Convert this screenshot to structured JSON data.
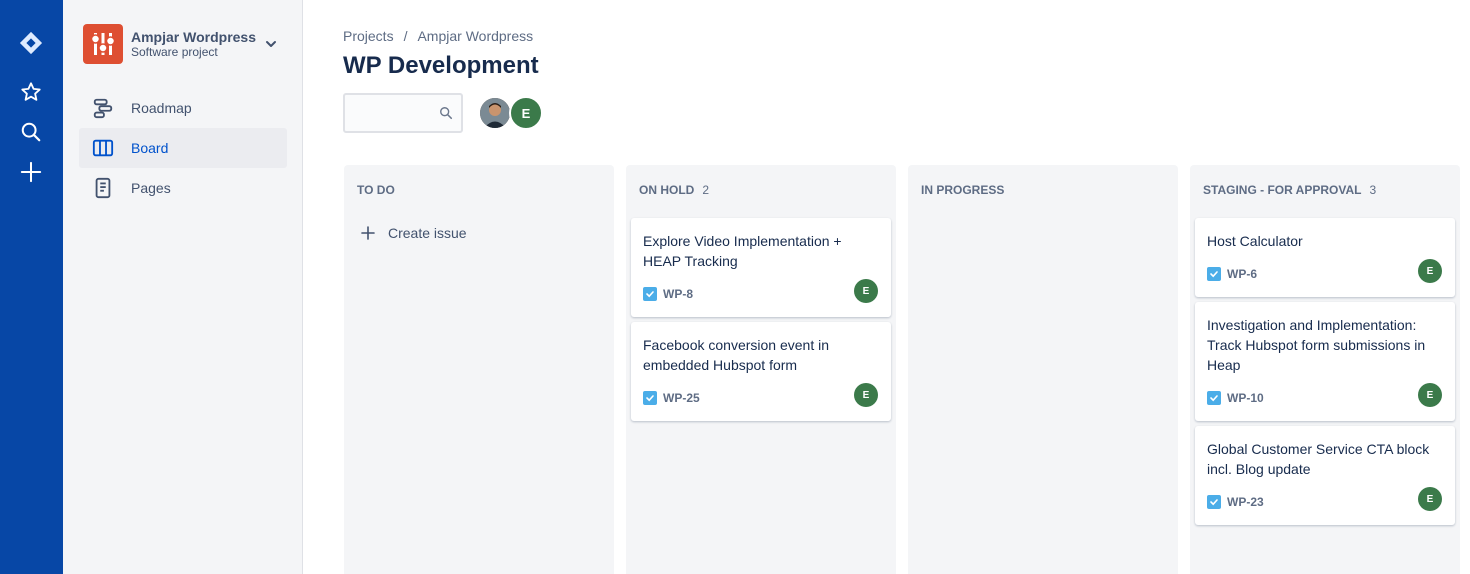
{
  "global_nav": {
    "icons": [
      "jira-logo-icon",
      "star-icon",
      "search-icon",
      "plus-icon"
    ],
    "color": "#0747A6"
  },
  "sidebar": {
    "project_name": "Ampjar Wordpress",
    "project_type": "Software project",
    "items": [
      {
        "label": "Roadmap",
        "icon": "roadmap-icon",
        "active": false
      },
      {
        "label": "Board",
        "icon": "board-icon",
        "active": true
      },
      {
        "label": "Pages",
        "icon": "pages-icon",
        "active": false
      }
    ]
  },
  "breadcrumb": {
    "items": [
      "Projects",
      "Ampjar Wordpress"
    ],
    "separator": "/"
  },
  "page_title": "WP Development",
  "search": {
    "placeholder": "",
    "value": ""
  },
  "assignees": [
    {
      "type": "photo",
      "initial": ""
    },
    {
      "type": "initial",
      "initial": "E"
    }
  ],
  "columns": [
    {
      "title": "TO DO",
      "count": "",
      "create_label": "Create issue",
      "cards": []
    },
    {
      "title": "ON HOLD",
      "count": "2",
      "cards": [
        {
          "title": "Explore Video Implementation + HEAP Tracking",
          "key": "WP-8",
          "assignee": "E"
        },
        {
          "title": "Facebook conversion event in embedded Hubspot form",
          "key": "WP-25",
          "assignee": "E"
        }
      ]
    },
    {
      "title": "IN PROGRESS",
      "count": "",
      "cards": []
    },
    {
      "title": "STAGING - FOR APPROVAL",
      "count": "3",
      "cards": [
        {
          "title": "Host Calculator",
          "key": "WP-6",
          "assignee": "E"
        },
        {
          "title": "Investigation and Implementation: Track Hubspot form submissions in Heap",
          "key": "WP-10",
          "assignee": "E"
        },
        {
          "title": "Global Customer Service CTA block incl. Blog update",
          "key": "WP-23",
          "assignee": "E"
        }
      ]
    }
  ],
  "colors": {
    "accent": "#0052CC",
    "project_avatar": "#DE4F32",
    "assignee": "#3B7A4A",
    "task_icon": "#4BADE8"
  }
}
